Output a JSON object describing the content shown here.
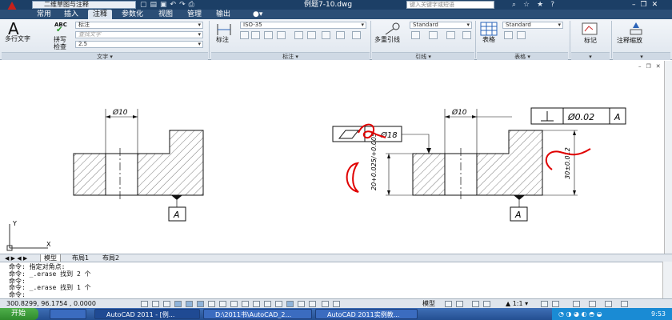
{
  "titlebar": {
    "workspace": "二维草图与注释",
    "document_title": "例题7-10.dwg",
    "help_search_placeholder": "键入关键字或短语"
  },
  "ribbon_tabs": [
    "常用",
    "插入",
    "注释",
    "参数化",
    "视图",
    "管理",
    "输出"
  ],
  "active_tab": "注释",
  "ribbon": {
    "text_panel": {
      "multiline_text": "多行文字",
      "spell_check_line1": "拼写",
      "spell_check_line2": "检查",
      "abc": "ABC",
      "text_style": "标注",
      "find_text_placeholder": "查找文字",
      "text_height": "2.5",
      "title": "文字"
    },
    "dim_panel": {
      "dimension": "标注",
      "dim_style": "ISO-35",
      "title": "标注"
    },
    "leader_panel": {
      "multileader": "多重引线",
      "leader_style": "Standard",
      "title": "引线"
    },
    "table_panel": {
      "table": "表格",
      "table_style": "Standard",
      "title": "表格"
    },
    "markup_panel": {
      "mark": "标记"
    },
    "scale_panel": {
      "annotation_scale": "注释缩放"
    }
  },
  "drawing": {
    "left_part": {
      "diameter_label": "Ø10",
      "datum_label": "A"
    },
    "right_part": {
      "diameter_label": "Ø10",
      "datum_label": "A",
      "fcf_left_value": "Ø18",
      "fcf_right_value": "Ø0.02",
      "fcf_right_datum": "A",
      "dim_left": "20+0.025/+0.005",
      "dim_right": "30±0.012",
      "handwritten_mark": "6"
    }
  },
  "layout_tabs": [
    "模型",
    "布局1",
    "布局2"
  ],
  "active_layout_tab": "模型",
  "command_lines": [
    "命令: 指定对角点:",
    "命令: _.erase 找到 2 个",
    "命令:",
    "命令: _.erase 找到 1 个",
    "命令:"
  ],
  "status": {
    "coordinates": "300.8299, 96.1754 , 0.0000",
    "model_label": "模型",
    "annotation_scale": "1:1"
  },
  "taskbar": {
    "start": "开始",
    "tasks": [
      "AutoCAD 2011 - [例...",
      "D:\\2011书\\AutoCAD_2...",
      "AutoCAD 2011实例教..."
    ],
    "active_task": 0,
    "clock": "9:53"
  },
  "colors": {
    "title_bg": "#1c3f66",
    "tab_bg": "#2b4e76",
    "handwriting": "#e00000",
    "taskbar": "#244f91"
  }
}
